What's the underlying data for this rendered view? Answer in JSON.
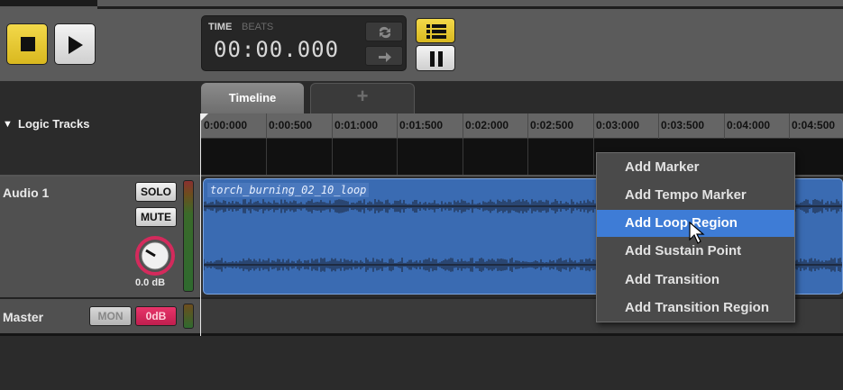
{
  "transport": {
    "stop_icon": "stop-icon",
    "play_icon": "play-icon",
    "time_label": "TIME",
    "beats_label": "BEATS",
    "time_readout": "00:00.000",
    "loop_icon": "loop-icon",
    "follow_icon": "follow-arrow-icon",
    "list_icon": "track-list-icon",
    "pause_icon": "pause-icon"
  },
  "tabs": [
    {
      "label": "Timeline"
    },
    {
      "label": "+"
    }
  ],
  "tracks_header": {
    "label": "Logic Tracks"
  },
  "ruler": {
    "ticks": [
      "0:00:000",
      "0:00:500",
      "0:01:000",
      "0:01:500",
      "0:02:000",
      "0:02:500",
      "0:03:000",
      "0:03:500",
      "0:04:000",
      "0:04:500"
    ]
  },
  "audio_track": {
    "name": "Audio 1",
    "solo_label": "SOLO",
    "mute_label": "MUTE",
    "volume": "0.0 dB",
    "clip_name": "torch_burning_02_10_loop"
  },
  "master_track": {
    "name": "Master",
    "mon_label": "MON",
    "volume_label": "0dB"
  },
  "context_menu": {
    "items": [
      {
        "label": "Add Marker"
      },
      {
        "label": "Add Tempo Marker"
      },
      {
        "label": "Add Loop Region",
        "highlighted": true
      },
      {
        "label": "Add Sustain Point"
      },
      {
        "label": "Add Transition"
      },
      {
        "label": "Add Transition Region"
      }
    ]
  },
  "colors": {
    "accent_yellow": "#e6c62e",
    "clip_blue": "#3a6bb2",
    "menu_highlight": "#3e7cd6",
    "master_volume": "#d8285a"
  }
}
